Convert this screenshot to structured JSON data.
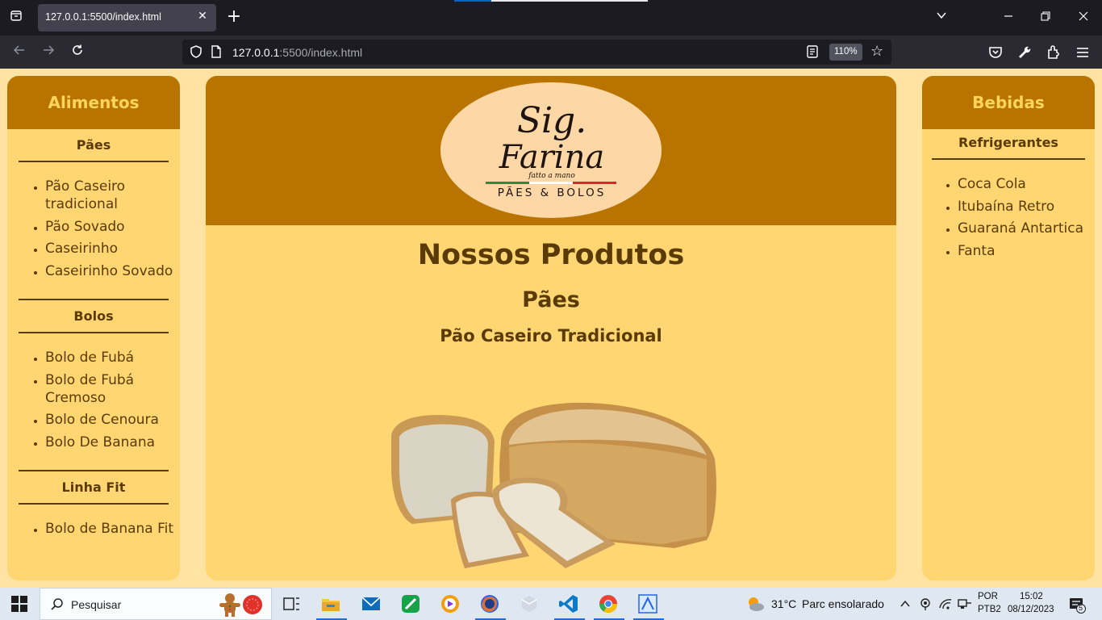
{
  "browser": {
    "tab_title": "127.0.0.1:5500/index.html",
    "url_host": "127.0.0.1",
    "url_rest": ":5500/index.html",
    "zoom": "110%"
  },
  "sidebar_left": {
    "title": "Alimentos",
    "categories": [
      {
        "title": "Pães",
        "items": [
          "Pão Caseiro tradicional",
          "Pão Sovado",
          "Caseirinho",
          "Caseirinho Sovado"
        ]
      },
      {
        "title": "Bolos",
        "items": [
          "Bolo de Fubá",
          "Bolo de Fubá Cremoso",
          "Bolo de Cenoura",
          "Bolo De Banana"
        ]
      },
      {
        "title": "Linha Fit",
        "items": [
          "Bolo de Banana Fit"
        ]
      }
    ]
  },
  "sidebar_right": {
    "title": "Bebidas",
    "categories": [
      {
        "title": "Refrigerantes",
        "items": [
          "Coca Cola",
          "Itubaína Retro",
          "Guaraná Antartica",
          "Fanta"
        ]
      }
    ]
  },
  "logo": {
    "line1": "Sig.",
    "line2": "Farina",
    "tagline": "fatto a mano",
    "subtitle": "PÃES & BOLOS"
  },
  "main": {
    "heading": "Nossos Produtos",
    "section": "Pães",
    "product": "Pão Caseiro Tradicional"
  },
  "taskbar": {
    "search_label": "Pesquisar",
    "temperature": "31°C",
    "weather": "Parc ensolarado",
    "lang1": "POR",
    "lang2": "PTB2",
    "time": "15:02",
    "date": "08/12/2023",
    "notif_count": "5"
  },
  "colors": {
    "brand_brown": "#b97400",
    "panel_yellow": "#ffd672",
    "page_bg": "#ffe3a2",
    "text_brown": "#5a3a05",
    "heading_gold": "#ffd65a"
  }
}
